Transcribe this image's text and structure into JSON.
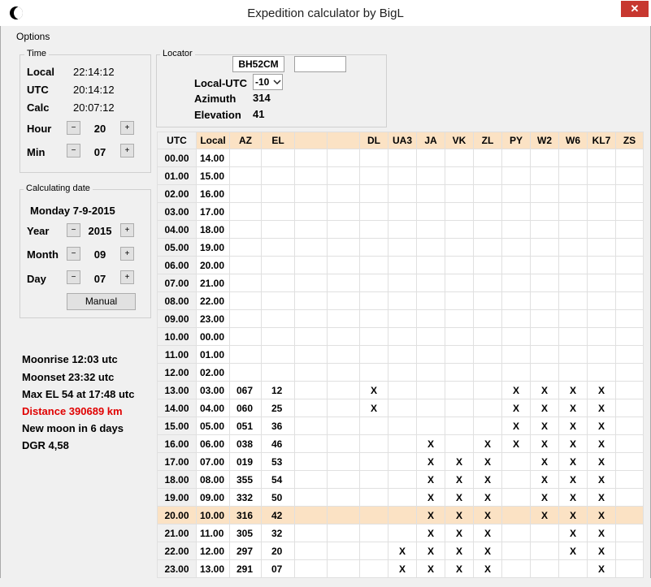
{
  "window": {
    "title": "Expedition calculator by BigL",
    "close_glyph": "✕"
  },
  "menu": {
    "options": "Options"
  },
  "time": {
    "legend": "Time",
    "local_label": "Local",
    "local_value": "22:14:12",
    "utc_label": "UTC",
    "utc_value": "20:14:12",
    "calc_label": "Calc",
    "calc_value": "20:07:12",
    "hour_label": "Hour",
    "hour_value": "20",
    "min_label": "Min",
    "min_value": "07",
    "minus": "−",
    "plus": "+"
  },
  "date": {
    "legend": "Calculating date",
    "heading": "Monday 7-9-2015",
    "year_label": "Year",
    "year_value": "2015",
    "month_label": "Month",
    "month_value": "09",
    "day_label": "Day",
    "day_value": "07",
    "manual_button": "Manual"
  },
  "locator": {
    "legend": "Locator",
    "value": "BH52CM",
    "extra_value": "",
    "local_utc_label": "Local-UTC",
    "local_utc_value": "-10",
    "azimuth_label": "Azimuth",
    "azimuth_value": "314",
    "elevation_label": "Elevation",
    "elevation_value": "41"
  },
  "info": {
    "moonrise": "Moonrise 12:03 utc",
    "moonset": "Moonset 23:32 utc",
    "max_el": "Max EL 54 at 17:48 utc",
    "distance": "Distance 390689 km",
    "new_moon": "New moon in 6 days",
    "dgr": "DGR 4,58"
  },
  "colors": {
    "highlight": "#fbe2c4",
    "distance_red": "#e00000",
    "close_red": "#c7372f"
  },
  "table": {
    "headers": [
      "UTC",
      "Local",
      "AZ",
      "EL",
      "",
      "",
      "DL",
      "UA3",
      "JA",
      "VK",
      "ZL",
      "PY",
      "W2",
      "W6",
      "KL7",
      "ZS"
    ],
    "highlight_row": 20,
    "rows": [
      [
        "00.00",
        "14.00",
        "",
        "",
        "",
        "",
        "",
        "",
        "",
        "",
        "",
        "",
        "",
        "",
        "",
        ""
      ],
      [
        "01.00",
        "15.00",
        "",
        "",
        "",
        "",
        "",
        "",
        "",
        "",
        "",
        "",
        "",
        "",
        "",
        ""
      ],
      [
        "02.00",
        "16.00",
        "",
        "",
        "",
        "",
        "",
        "",
        "",
        "",
        "",
        "",
        "",
        "",
        "",
        ""
      ],
      [
        "03.00",
        "17.00",
        "",
        "",
        "",
        "",
        "",
        "",
        "",
        "",
        "",
        "",
        "",
        "",
        "",
        ""
      ],
      [
        "04.00",
        "18.00",
        "",
        "",
        "",
        "",
        "",
        "",
        "",
        "",
        "",
        "",
        "",
        "",
        "",
        ""
      ],
      [
        "05.00",
        "19.00",
        "",
        "",
        "",
        "",
        "",
        "",
        "",
        "",
        "",
        "",
        "",
        "",
        "",
        ""
      ],
      [
        "06.00",
        "20.00",
        "",
        "",
        "",
        "",
        "",
        "",
        "",
        "",
        "",
        "",
        "",
        "",
        "",
        ""
      ],
      [
        "07.00",
        "21.00",
        "",
        "",
        "",
        "",
        "",
        "",
        "",
        "",
        "",
        "",
        "",
        "",
        "",
        ""
      ],
      [
        "08.00",
        "22.00",
        "",
        "",
        "",
        "",
        "",
        "",
        "",
        "",
        "",
        "",
        "",
        "",
        "",
        ""
      ],
      [
        "09.00",
        "23.00",
        "",
        "",
        "",
        "",
        "",
        "",
        "",
        "",
        "",
        "",
        "",
        "",
        "",
        ""
      ],
      [
        "10.00",
        "00.00",
        "",
        "",
        "",
        "",
        "",
        "",
        "",
        "",
        "",
        "",
        "",
        "",
        "",
        ""
      ],
      [
        "11.00",
        "01.00",
        "",
        "",
        "",
        "",
        "",
        "",
        "",
        "",
        "",
        "",
        "",
        "",
        "",
        ""
      ],
      [
        "12.00",
        "02.00",
        "",
        "",
        "",
        "",
        "",
        "",
        "",
        "",
        "",
        "",
        "",
        "",
        "",
        ""
      ],
      [
        "13.00",
        "03.00",
        "067",
        "12",
        "",
        "",
        "X",
        "",
        "",
        "",
        "",
        "X",
        "X",
        "X",
        "X",
        ""
      ],
      [
        "14.00",
        "04.00",
        "060",
        "25",
        "",
        "",
        "X",
        "",
        "",
        "",
        "",
        "X",
        "X",
        "X",
        "X",
        ""
      ],
      [
        "15.00",
        "05.00",
        "051",
        "36",
        "",
        "",
        "",
        "",
        "",
        "",
        "",
        "X",
        "X",
        "X",
        "X",
        ""
      ],
      [
        "16.00",
        "06.00",
        "038",
        "46",
        "",
        "",
        "",
        "",
        "X",
        "",
        "X",
        "X",
        "X",
        "X",
        "X",
        ""
      ],
      [
        "17.00",
        "07.00",
        "019",
        "53",
        "",
        "",
        "",
        "",
        "X",
        "X",
        "X",
        "",
        "X",
        "X",
        "X",
        ""
      ],
      [
        "18.00",
        "08.00",
        "355",
        "54",
        "",
        "",
        "",
        "",
        "X",
        "X",
        "X",
        "",
        "X",
        "X",
        "X",
        ""
      ],
      [
        "19.00",
        "09.00",
        "332",
        "50",
        "",
        "",
        "",
        "",
        "X",
        "X",
        "X",
        "",
        "X",
        "X",
        "X",
        ""
      ],
      [
        "20.00",
        "10.00",
        "316",
        "42",
        "",
        "",
        "",
        "",
        "X",
        "X",
        "X",
        "",
        "X",
        "X",
        "X",
        ""
      ],
      [
        "21.00",
        "11.00",
        "305",
        "32",
        "",
        "",
        "",
        "",
        "X",
        "X",
        "X",
        "",
        "",
        "X",
        "X",
        ""
      ],
      [
        "22.00",
        "12.00",
        "297",
        "20",
        "",
        "",
        "",
        "X",
        "X",
        "X",
        "X",
        "",
        "",
        "X",
        "X",
        ""
      ],
      [
        "23.00",
        "13.00",
        "291",
        "07",
        "",
        "",
        "",
        "X",
        "X",
        "X",
        "X",
        "",
        "",
        "",
        "X",
        ""
      ]
    ]
  }
}
